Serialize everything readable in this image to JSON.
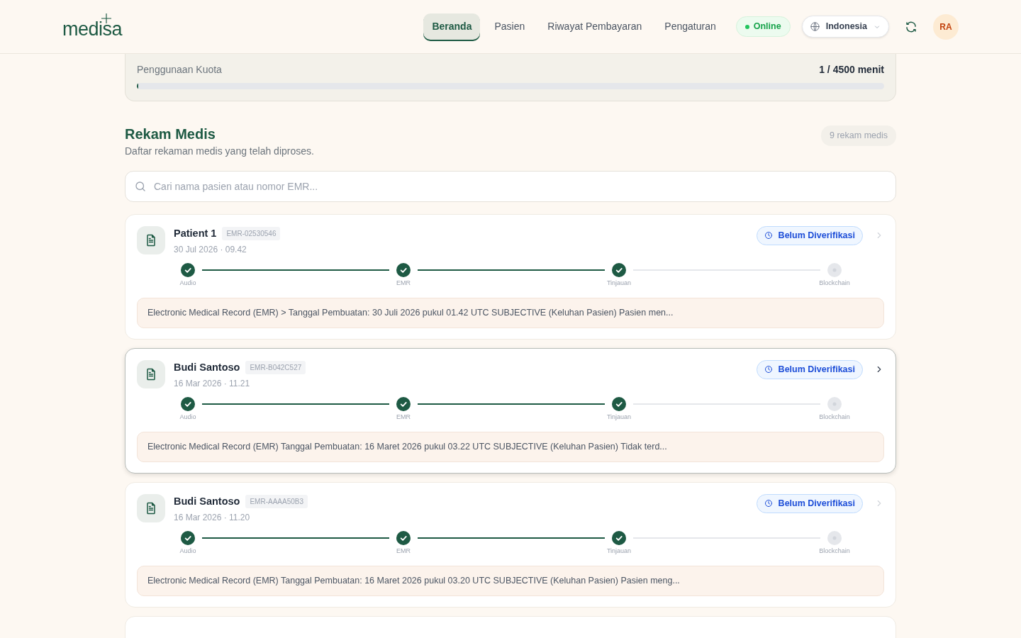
{
  "brand": {
    "name": "medisa"
  },
  "nav": [
    {
      "label": "Beranda",
      "selected": true
    },
    {
      "label": "Pasien",
      "selected": false
    },
    {
      "label": "Riwayat Pembayaran",
      "selected": false
    },
    {
      "label": "Pengaturan",
      "selected": false
    }
  ],
  "status": {
    "label": "Online",
    "on": true
  },
  "language": {
    "label": "Indonesia"
  },
  "avatar": {
    "initials": "RA"
  },
  "quota": {
    "label": "Penggunaan Kuota",
    "reading": "1 / 4500 menit",
    "level": 0.0002
  },
  "section": {
    "title": "Rekam Medis",
    "subtitle": "Daftar rekaman medis yang telah diproses.",
    "count": "9 rekam medis"
  },
  "search": {
    "placeholder": "Cari nama pasien atau nomor EMR..."
  },
  "records": [
    {
      "name": "Patient 1",
      "emr": "EMR-02530546",
      "date": "30 Jul 2026 · 09.42",
      "status": "Belum Diverifikasi",
      "hovered": false,
      "steps": [
        {
          "label": "Audio",
          "done": true
        },
        {
          "label": "EMR",
          "done": true
        },
        {
          "label": "Tinjauan",
          "done": true
        },
        {
          "label": "Blockchain",
          "done": false
        }
      ],
      "summary": "Electronic Medical Record (EMR) > Tanggal Pembuatan: 30 Juli 2026 pukul 01.42 UTC SUBJECTIVE (Keluhan Pasien) Pasien men..."
    },
    {
      "name": "Budi Santoso",
      "emr": "EMR-B042C527",
      "date": "16 Mar 2026 · 11.21",
      "status": "Belum Diverifikasi",
      "hovered": true,
      "steps": [
        {
          "label": "Audio",
          "done": true
        },
        {
          "label": "EMR",
          "done": true
        },
        {
          "label": "Tinjauan",
          "done": true
        },
        {
          "label": "Blockchain",
          "done": false
        }
      ],
      "summary": "Electronic Medical Record (EMR) Tanggal Pembuatan: 16 Maret 2026 pukul 03.22 UTC SUBJECTIVE (Keluhan Pasien) Tidak terd..."
    },
    {
      "name": "Budi Santoso",
      "emr": "EMR-AAAA50B3",
      "date": "16 Mar 2026 · 11.20",
      "status": "Belum Diverifikasi",
      "hovered": false,
      "steps": [
        {
          "label": "Audio",
          "done": true
        },
        {
          "label": "EMR",
          "done": true
        },
        {
          "label": "Tinjauan",
          "done": true
        },
        {
          "label": "Blockchain",
          "done": false
        }
      ],
      "summary": "Electronic Medical Record (EMR) Tanggal Pembuatan: 16 Maret 2026 pukul 03.20 UTC SUBJECTIVE (Keluhan Pasien) Pasien meng..."
    }
  ]
}
